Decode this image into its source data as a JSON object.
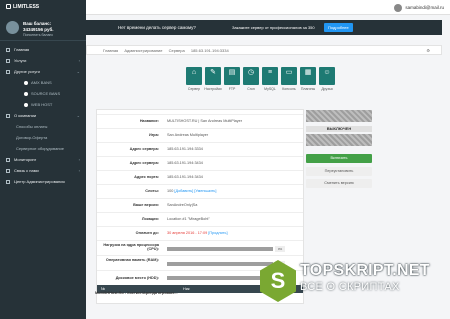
{
  "brand": {
    "name": "LIMITLESS"
  },
  "topbar": {
    "user_email": "samabindi@mail.ru"
  },
  "sidebar": {
    "balance": {
      "title": "Ваш баланс:",
      "amount": "34349156 руб.",
      "topup": "Пополнить баланс"
    },
    "items": [
      {
        "label": "Главная",
        "icon": "home-icon",
        "arrow": false
      },
      {
        "label": "Услуги",
        "icon": "tasks-icon",
        "arrow": true
      },
      {
        "label": "Другие услуги",
        "icon": "grid-icon",
        "arrow": true
      }
    ],
    "sub_items": [
      {
        "label": "AMX BANS"
      },
      {
        "label": "SOURCE BANS"
      },
      {
        "label": "WEB HOST"
      }
    ],
    "items2": [
      {
        "label": "О компании",
        "icon": "info-icon",
        "arrow": true
      }
    ],
    "sub_items2": [
      {
        "label": "Способы оплаты"
      },
      {
        "label": "Договор-Оферта"
      },
      {
        "label": "Серверное оборудование"
      }
    ],
    "items3": [
      {
        "label": "Мониторинг",
        "icon": "chart-icon",
        "arrow": true
      },
      {
        "label": "Связь с нами",
        "icon": "mail-icon",
        "arrow": true
      },
      {
        "label": "Центр Администрирования",
        "icon": "shield-icon",
        "arrow": false
      }
    ]
  },
  "promo": {
    "question": "Нет времени делать сервер самому?",
    "offer": "Закажите сервер от профессионалов за 350",
    "button": "Подробнее"
  },
  "breadcrumb": {
    "items": [
      "Главная",
      "Администрирование",
      "Сервера",
      "185.63.191.194:3334"
    ],
    "settings": "⚙"
  },
  "tools": [
    {
      "label": "Сервер",
      "icon": "home-icon",
      "glyph": "⌂"
    },
    {
      "label": "Настройки",
      "icon": "wrench-icon",
      "glyph": "✎"
    },
    {
      "label": "FTP",
      "icon": "folder-icon",
      "glyph": "▤"
    },
    {
      "label": "Cron",
      "icon": "clock-icon",
      "glyph": "◷"
    },
    {
      "label": "MySQL",
      "icon": "database-icon",
      "glyph": "≡"
    },
    {
      "label": "Консоль",
      "icon": "terminal-icon",
      "glyph": "▭"
    },
    {
      "label": "Плагины",
      "icon": "puzzle-icon",
      "glyph": "▦"
    },
    {
      "label": "Друзья",
      "icon": "users-icon",
      "glyph": "☺"
    }
  ],
  "details": {
    "name": {
      "key": "Название:",
      "value": "MULTISHOST.RU | San Andreas MultiPlayer"
    },
    "game": {
      "key": "Игра:",
      "value": "San Andreas Multiplayer"
    },
    "address": {
      "key": "Адрес сервера:",
      "value": "185.63.191.194:3334"
    },
    "ip": {
      "key": "Адрес сервера:",
      "value": "185.63.191.194:3434"
    },
    "port": {
      "key": "Адрес порта:",
      "value": "185.63.191.194:3434"
    },
    "slots": {
      "key": "Слоты:",
      "value": "100",
      "add": "[Добавить]",
      "reduce": "[Уменьшить]"
    },
    "owner": {
      "key": "Ваше версия:",
      "value": "SanAndreOnly|Sa"
    },
    "location": {
      "key": "Локация:",
      "value": "Location #1 \"MirageBoht\""
    },
    "paid": {
      "key": "Оплачен до:",
      "date": "30 апреля 2016 - 17:09",
      "renew": "[Продлить]"
    },
    "cpu": {
      "key": "Нагрузка на ядра процессора (CPU):",
      "percent": 0,
      "label": "0%"
    },
    "ram": {
      "key": "Оперативная память (RAM):",
      "percent": 0,
      "label": "0%"
    },
    "disk": {
      "key": "Дисковое место (HDD):",
      "percent": 0,
      "label": "0%"
    }
  },
  "players_table": {
    "col_num": "№",
    "col_nick": "Ник"
  },
  "side": {
    "status": "ВЫКЛЮЧЕН",
    "btn_start": "Включить",
    "btn_reinstall": "Переустановить",
    "btn_change": "Сменить версию"
  },
  "footer": {
    "text": "MultiSHHost.Ru - Хостинг/Аренда игровых..."
  },
  "watermark": {
    "logo_letter": "S",
    "line1": "TOPSKRIPT.NET",
    "line2": "ВСЕ О СКРИПТАХ"
  }
}
